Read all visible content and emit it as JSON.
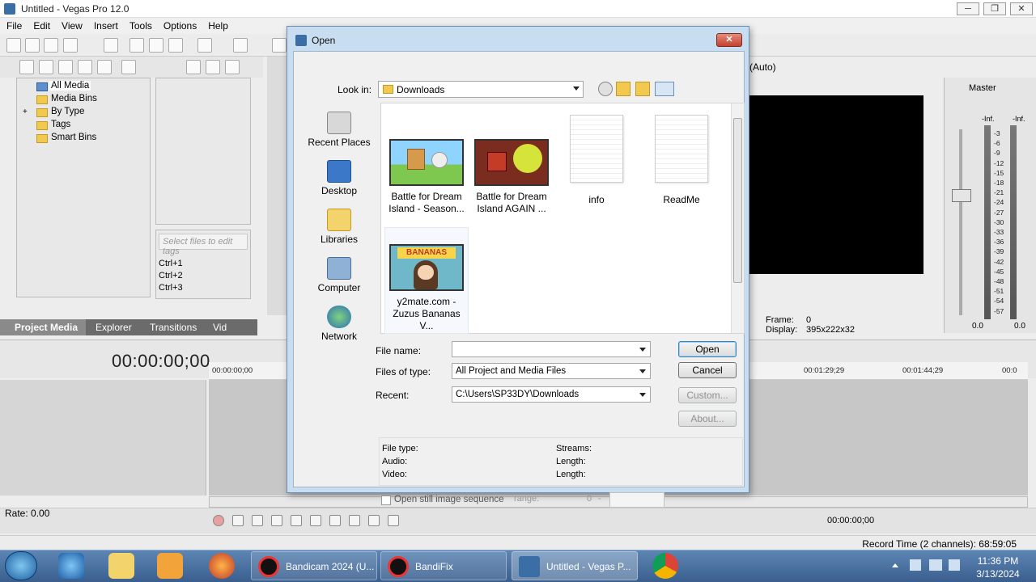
{
  "window": {
    "title": "Untitled - Vegas Pro 12.0",
    "min": "─",
    "max": "❐",
    "close": "✕"
  },
  "menu": [
    "File",
    "Edit",
    "View",
    "Insert",
    "Tools",
    "Options",
    "Help"
  ],
  "media_tree": [
    "All Media",
    "Media Bins",
    "By Type",
    "Tags",
    "Smart Bins"
  ],
  "tags": {
    "placeholder": "Select files to edit tags",
    "shortcuts": [
      "Ctrl+1",
      "Ctrl+2",
      "Ctrl+3"
    ]
  },
  "tabs": [
    "Project Media",
    "Explorer",
    "Transitions",
    "Vid"
  ],
  "timeline": {
    "timecode": "00:00:00;00",
    "ruler": [
      "00:00:00;00",
      "00:01:29;29",
      "00:01:44;29",
      "00:0"
    ],
    "rate": "Rate: 0.00",
    "small_timecode": "00:00:00;00",
    "record_time": "Record Time (2 channels): 68:59:05"
  },
  "preview": {
    "auto": "(Auto)",
    "frame_label": "Frame:",
    "frame_value": "0",
    "display_label": "Display:",
    "display_value": "395x222x32"
  },
  "mixer": {
    "title": "Master",
    "inf_left": "-Inf.",
    "inf_right": "-Inf.",
    "scale": [
      "3",
      "6",
      "9",
      "12",
      "15",
      "18",
      "21",
      "24",
      "27",
      "30",
      "33",
      "36",
      "39",
      "42",
      "45",
      "48",
      "51",
      "54",
      "57"
    ],
    "bottom_left": "0.0",
    "bottom_right": "0.0"
  },
  "dialog": {
    "title": "Open",
    "close": "✕",
    "look_in_label": "Look in:",
    "look_in_value": "Downloads",
    "places": [
      "Recent Places",
      "Desktop",
      "Libraries",
      "Computer",
      "Network"
    ],
    "files": [
      {
        "name1": "Battle for Dream",
        "name2": "Island - Season..."
      },
      {
        "name1": "Battle for Dream",
        "name2": "Island AGAIN ..."
      },
      {
        "name1": "info",
        "name2": ""
      },
      {
        "name1": "ReadMe",
        "name2": ""
      },
      {
        "name1": "y2mate.com -",
        "name2": "Zuzus Bananas  V..."
      }
    ],
    "thumb_text": "BANANAS",
    "file_name_label": "File name:",
    "file_name_value": "",
    "files_of_type_label": "Files of type:",
    "files_of_type_value": "All Project and Media Files",
    "recent_label": "Recent:",
    "recent_value": "C:\\Users\\SP33DY\\Downloads",
    "buttons": {
      "open": "Open",
      "cancel": "Cancel",
      "custom": "Custom...",
      "about": "About..."
    },
    "info": {
      "file_type": "File type:",
      "audio": "Audio:",
      "video": "Video:",
      "streams": "Streams:",
      "length1": "Length:",
      "length2": "Length:"
    },
    "still_seq": "Open still image sequence",
    "range_label": "range:",
    "range_from": "0",
    "range_dash": "-"
  },
  "taskbar": {
    "items": [
      "Bandicam 2024 (U...",
      "BandiFix",
      "Untitled - Vegas P..."
    ],
    "time": "11:36 PM",
    "date": "3/13/2024"
  }
}
